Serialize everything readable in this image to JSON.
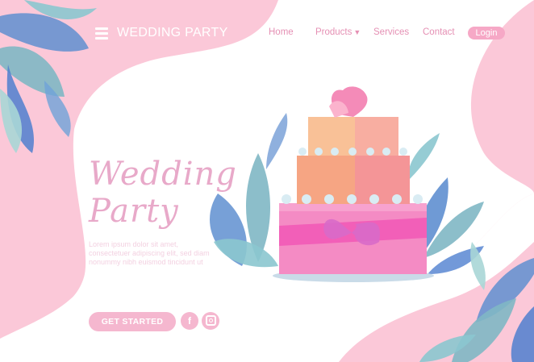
{
  "nav": {
    "brand": "WEDDING PARTY",
    "links": [
      "Home",
      "Products",
      "Services",
      "Contact"
    ],
    "login": "Login"
  },
  "hero": {
    "title_line1": "Wedding",
    "title_line2": "Party",
    "description": "Lorem ipsum dolor sit amet, consectetuer adipiscing elit, sed diam nonummy nibh euismod tincidunt ut",
    "cta": "GET STARTED"
  },
  "social": {
    "facebook_glyph": "f"
  },
  "icons": [
    "hamburger-menu-icon",
    "chevron-down-icon",
    "facebook-icon",
    "instagram-icon"
  ],
  "colors": {
    "pink_bg": "#fbc8d8",
    "accent_pink": "#e590b4",
    "button_pink": "#f5b7cf",
    "leaf_blue": "#5f8fd0",
    "leaf_teal": "#7fb7c4",
    "cake_peach": "#f7c19c",
    "cake_magenta": "#f25fb8"
  }
}
